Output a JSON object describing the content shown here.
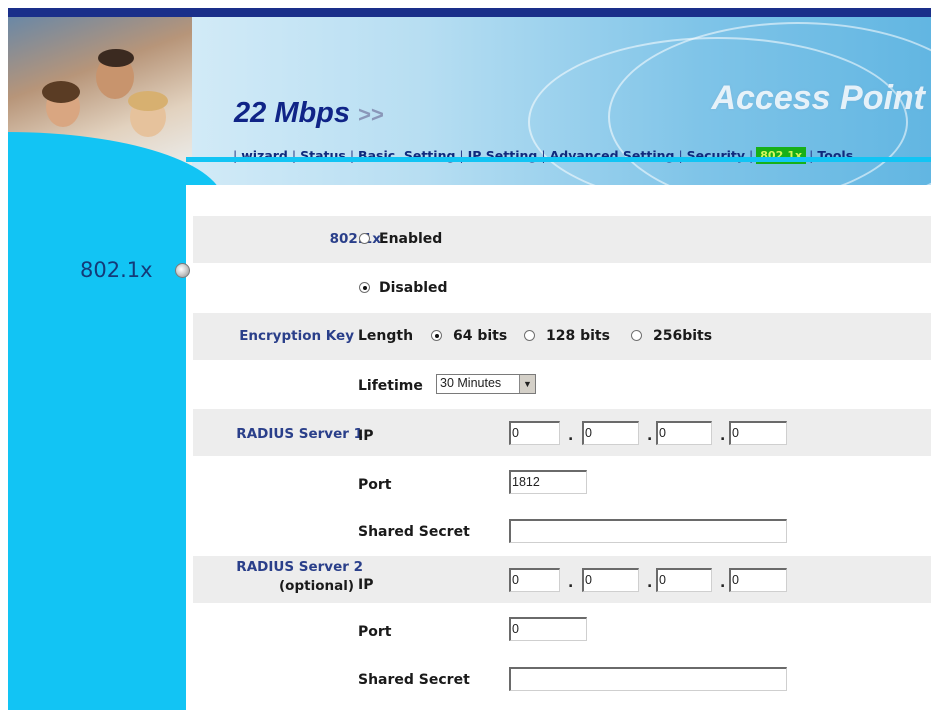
{
  "header": {
    "speed": "22 Mbps",
    "speed_arrows": ">>",
    "brand": "Access Point"
  },
  "nav": [
    {
      "label": "wizard",
      "active": false
    },
    {
      "label": "Status",
      "active": false
    },
    {
      "label": "Basic  Setting",
      "active": false
    },
    {
      "label": "IP Setting",
      "active": false
    },
    {
      "label": "Advanced Setting",
      "active": false
    },
    {
      "label": "Security",
      "active": false
    },
    {
      "label": "802.1x",
      "active": true
    },
    {
      "label": "Tools",
      "active": false
    }
  ],
  "sidebar": {
    "title": "802.1x"
  },
  "form": {
    "dot1x_label": "802.1x",
    "enabled_label": "Enabled",
    "disabled_label": "Disabled",
    "dot1x_value": "Disabled",
    "encryption_key_label": "Encryption Key",
    "length_label": "Length",
    "length_options": [
      "64 bits",
      "128 bits",
      "256bits"
    ],
    "length_value": "64 bits",
    "lifetime_label": "Lifetime",
    "lifetime_value": "30 Minutes",
    "radius1": {
      "label": "RADIUS Server 1",
      "ip_label": "IP",
      "ip": [
        "0",
        "0",
        "0",
        "0"
      ],
      "port_label": "Port",
      "port": "1812",
      "secret_label": "Shared Secret",
      "secret": ""
    },
    "radius2": {
      "label_line1": "RADIUS Server 2",
      "label_line2": "(optional)",
      "ip_label": "IP",
      "ip": [
        "0",
        "0",
        "0",
        "0"
      ],
      "port_label": "Port",
      "port": "0",
      "secret_label": "Shared Secret",
      "secret": ""
    }
  },
  "colors": {
    "sidebar": "#12c4f4",
    "nav_active_bg": "#18b018",
    "label_blue": "#2a3f8a",
    "row_shade": "#ededed"
  }
}
